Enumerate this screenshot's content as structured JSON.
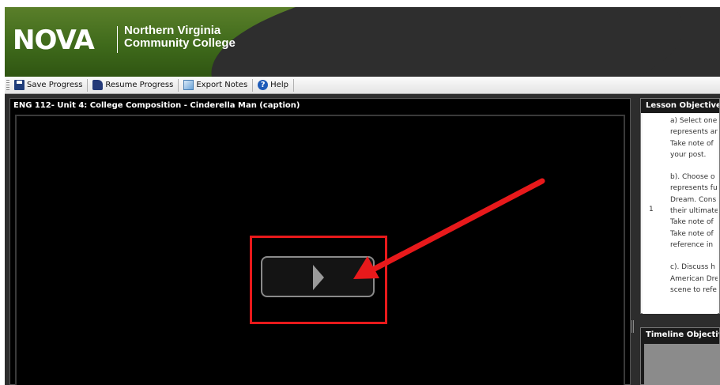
{
  "header": {
    "logo_text": "NOVA",
    "college_line1": "Northern Virginia",
    "college_line2": "Community College"
  },
  "toolbar": {
    "save_label": "Save Progress",
    "resume_label": "Resume Progress",
    "export_label": "Export Notes",
    "help_label": "Help"
  },
  "player": {
    "title": "ENG 112- Unit 4: College Composition - Cinderella Man (caption)"
  },
  "lesson_panel": {
    "title": "Lesson Objectives",
    "item_number": "1",
    "lines": [
      "a) Select one",
      "represents ar",
      "Take note of",
      "your post.",
      "b). Choose o",
      "represents fu",
      "Dream. Cons",
      "their ultimate",
      "Take note of",
      "Take note of",
      "reference in",
      "c). Discuss h",
      "American Dre",
      "scene to refe"
    ]
  },
  "timeline_panel": {
    "title": "Timeline Objectives"
  },
  "annotation": {
    "color": "#e8191b"
  },
  "colors": {
    "header_green": "#3f6a1b",
    "header_dark": "#2e2e2e",
    "stage": "#2d2d2d"
  }
}
